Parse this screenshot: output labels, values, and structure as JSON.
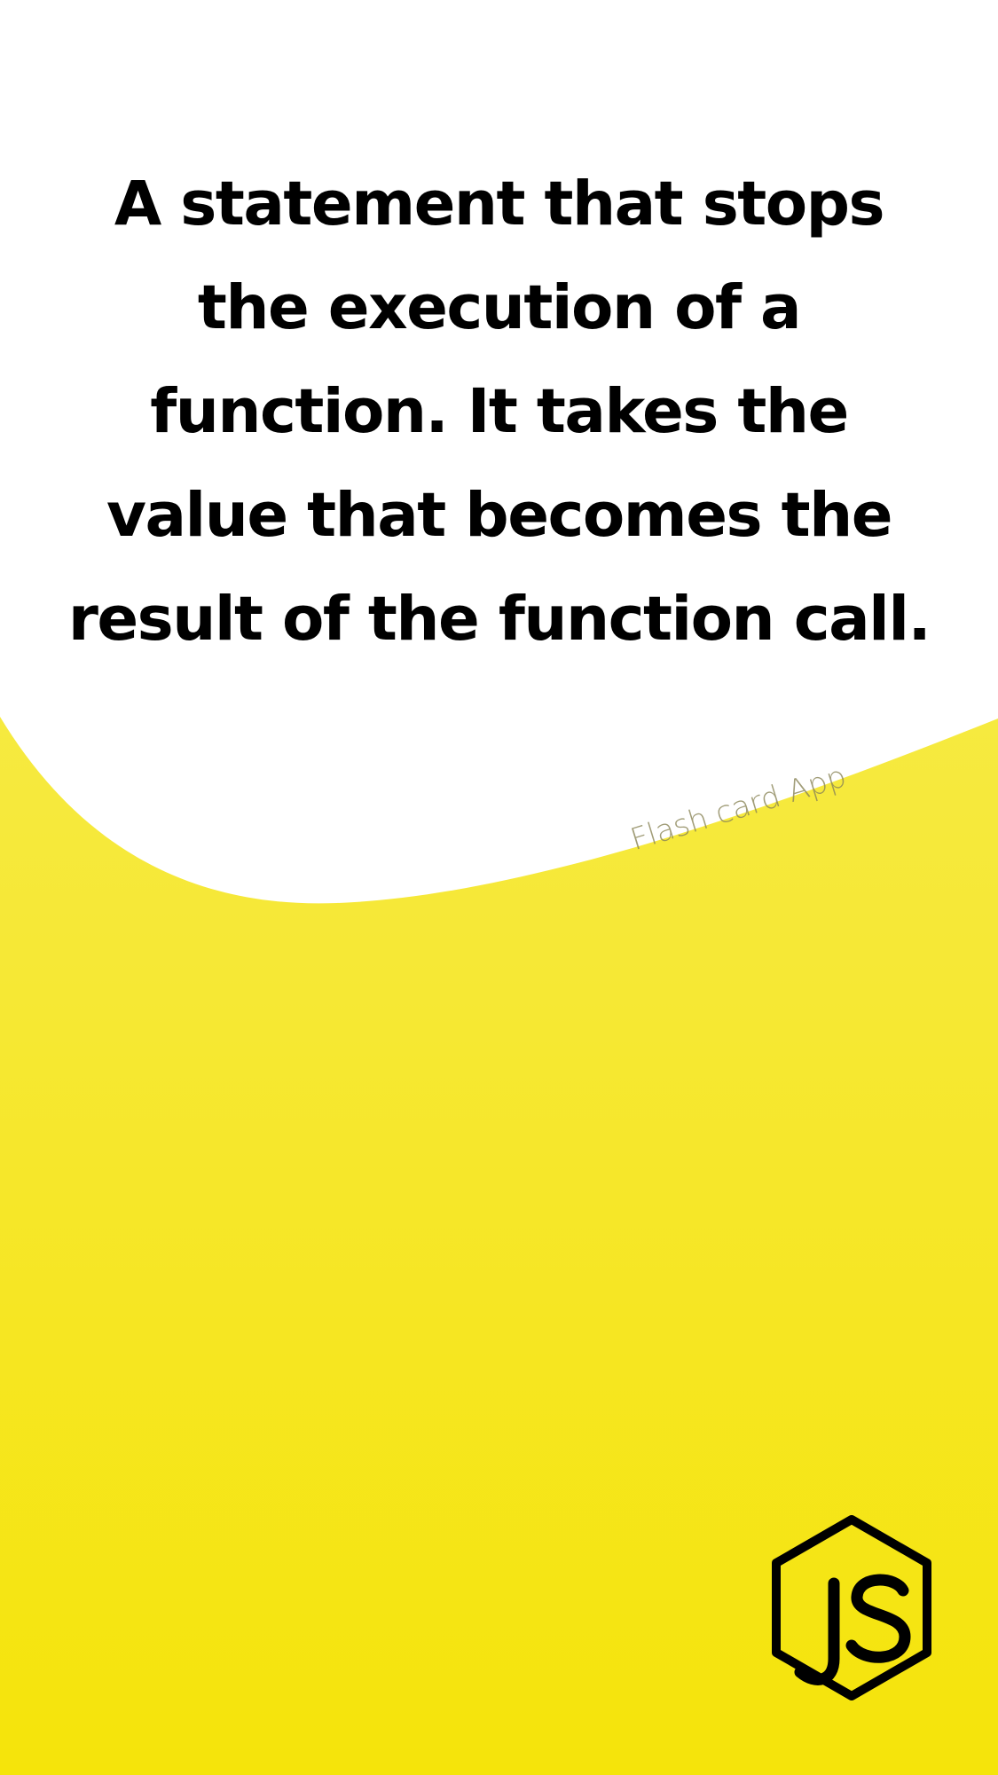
{
  "card": {
    "text": "A statement that stops the execution of a function. It takes the value that becomes the result of the function call."
  },
  "watermark": {
    "text": "Flash card App"
  },
  "logo": {
    "icon": "js-hexagon-icon",
    "label": "JS"
  },
  "colors": {
    "accent_yellow": "#f5e40a",
    "background_white": "#ffffff",
    "text_black": "#000000"
  }
}
